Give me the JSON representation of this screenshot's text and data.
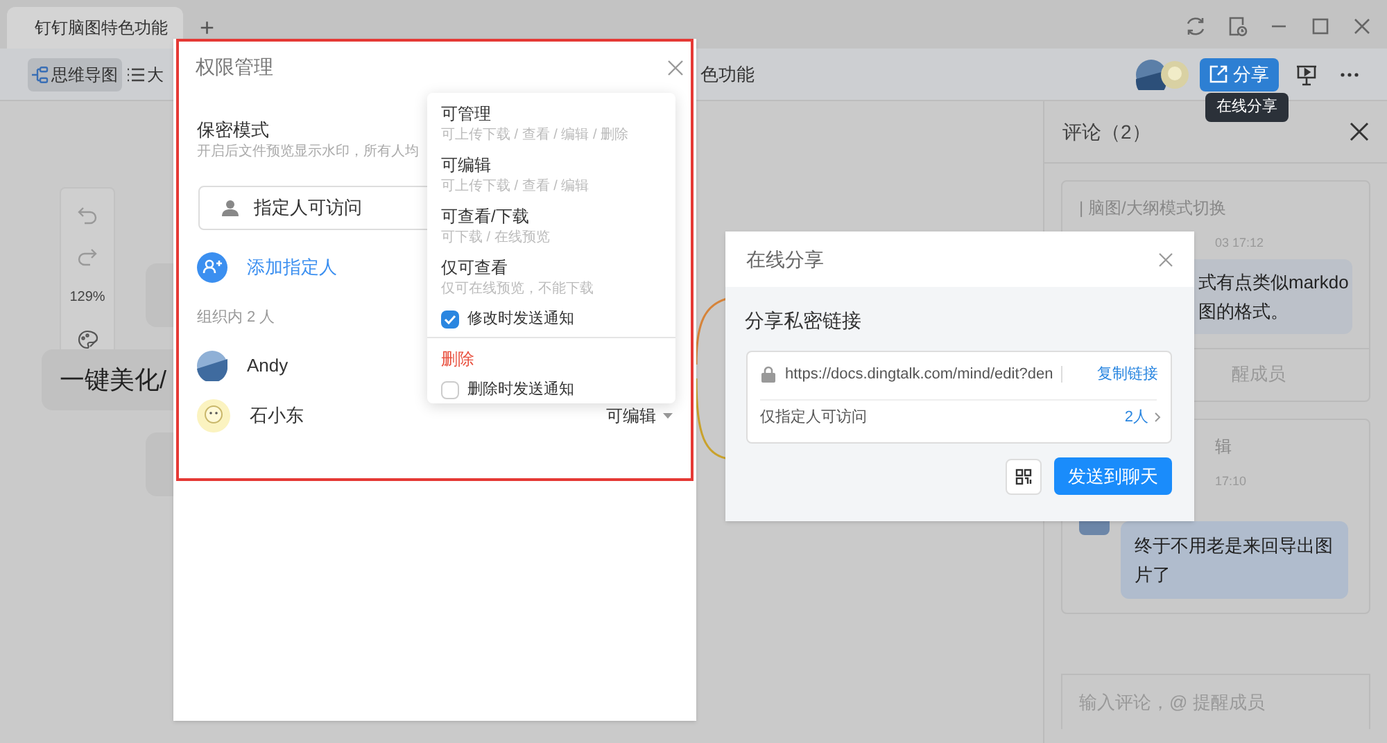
{
  "tabbar": {
    "tab": {
      "title": "钉钉脑图特色功能",
      "selected": true
    },
    "new_tab": "+"
  },
  "toolbar": {
    "modes": [
      {
        "label": "思维导图",
        "selected": true
      },
      {
        "label": "大",
        "selected": false
      }
    ],
    "feature_label": "色功能",
    "share_button": "分享",
    "tooltip": "在线分享"
  },
  "float_toolbar": {
    "zoom": "129%"
  },
  "canvas": {
    "nodes": [
      {
        "text": "一键美化/"
      }
    ]
  },
  "comments": {
    "title": "评论（2）",
    "cards": [
      {
        "title": "| 脑图/大纲模式切换",
        "time": "03 17:12",
        "bubble": [
          "式有点类似markdo",
          "图的格式。"
        ],
        "reply_hint": "醒成员"
      },
      {
        "title": "辑",
        "time": "17:10",
        "bubble": [
          "终于不用老是来回导出图片了"
        ]
      }
    ],
    "input_placeholder": "输入评论，@ 提醒成员"
  },
  "permission_dialog": {
    "title": "权限管理",
    "secret_mode": {
      "title": "保密模式",
      "desc": "开启后文件预览显示水印，所有人均"
    },
    "access_field": "指定人可访问",
    "add_member": "添加指定人",
    "org_count": "组织内 2 人",
    "members": [
      {
        "name": "Andy"
      },
      {
        "name": "石小东",
        "role": "可编辑"
      }
    ],
    "menu": {
      "options": [
        {
          "title": "可管理",
          "desc": "可上传下载 / 查看 / 编辑 / 删除"
        },
        {
          "title": "可编辑",
          "desc": "可上传下载 / 查看 / 编辑"
        },
        {
          "title": "可查看/下载",
          "desc": "可下载 / 在线预览"
        },
        {
          "title": "仅可查看",
          "desc": "仅可在线预览，不能下载"
        }
      ],
      "notify": {
        "label": "修改时发送通知",
        "checked": true
      },
      "delete": "删除",
      "delete_notify": {
        "label": "删除时发送通知",
        "checked": false
      }
    }
  },
  "share_dialog": {
    "title": "在线分享",
    "heading": "分享私密链接",
    "url": "https://docs.dingtalk.com/mind/edit?den",
    "copy": "复制链接",
    "access": "仅指定人可访问",
    "count": "2人",
    "send": "发送到聊天"
  }
}
